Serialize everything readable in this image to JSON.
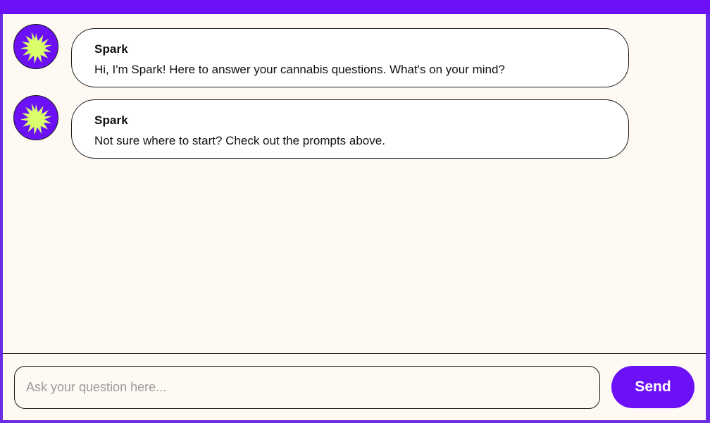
{
  "colors": {
    "brand_purple": "#6b10f7",
    "avatar_star": "#d9ff6b",
    "chat_background": "#fef9f3",
    "bubble_background": "#ffffff",
    "placeholder_text": "#9b9b9b"
  },
  "messages": [
    {
      "sender": "Spark",
      "text": "Hi, I'm Spark! Here to answer your cannabis questions. What's on your mind?",
      "avatar_icon": "starburst-icon"
    },
    {
      "sender": "Spark",
      "text": "Not sure where to start? Check out the prompts above.",
      "avatar_icon": "starburst-icon"
    }
  ],
  "composer": {
    "value": "",
    "placeholder": "Ask your question here...",
    "send_label": "Send"
  }
}
